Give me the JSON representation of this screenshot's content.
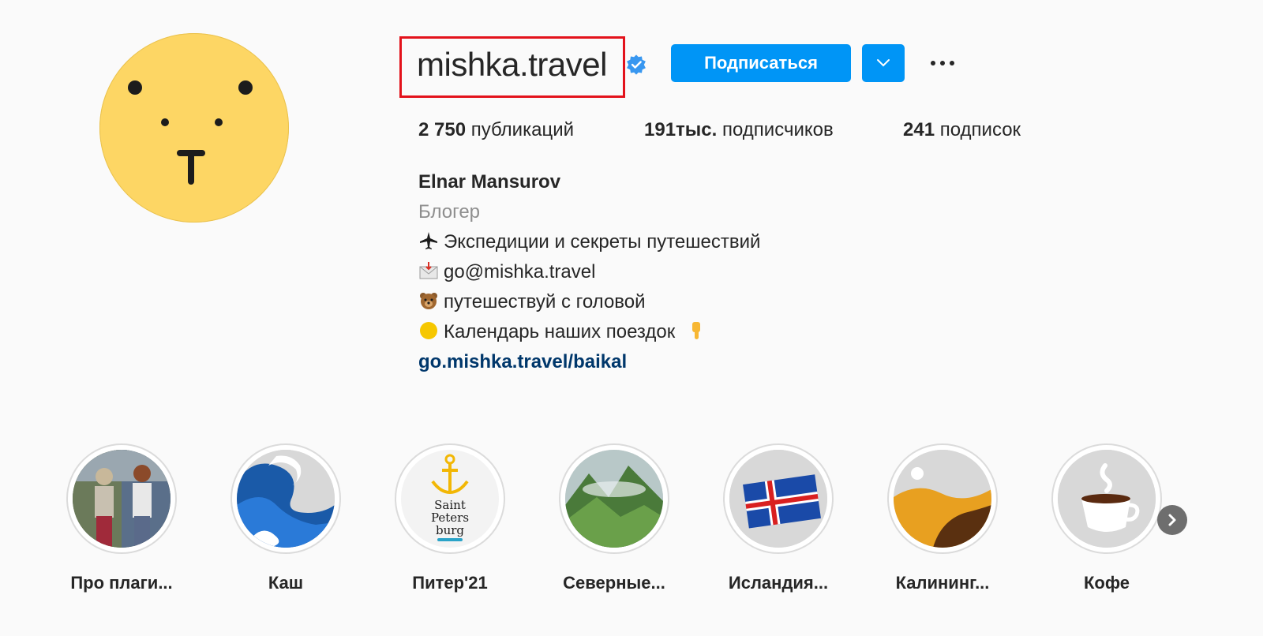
{
  "profile": {
    "username": "mishka.travel",
    "verified": true,
    "follow_label": "Подписаться",
    "stats": {
      "posts_count": "2 750",
      "posts_label": "публикаций",
      "followers_count": "191тыс.",
      "followers_label": "подписчиков",
      "following_count": "241",
      "following_label": "подписок"
    }
  },
  "bio": {
    "name": "Elnar Mansurov",
    "category": "Блогер",
    "lines": [
      {
        "icon": "airplane-emoji",
        "text": "Экспедиции и секреты путешествий"
      },
      {
        "icon": "envelope-emoji",
        "text": "go@mishka.travel"
      },
      {
        "icon": "bear-emoji",
        "text": "путешествуй с головой"
      },
      {
        "icon": "yellow-circle-emoji",
        "text": "Календарь наших поездок",
        "trailing_icon": "pointing-down-emoji"
      }
    ],
    "link": "go.mishka.travel/baikal"
  },
  "highlights": [
    {
      "label": "Про плаги...",
      "cover": "bears-photo"
    },
    {
      "label": "Каш",
      "cover": "wave-illustration"
    },
    {
      "label": "Питер'21",
      "cover": "anchor-logo",
      "cover_text": [
        "Saint",
        "Peters",
        "burg"
      ]
    },
    {
      "label": "Северные...",
      "cover": "mountains-photo"
    },
    {
      "label": "Исландия...",
      "cover": "iceland-flag"
    },
    {
      "label": "Калининг...",
      "cover": "dunes-illustration"
    },
    {
      "label": "Кофе",
      "cover": "coffee-cup-illustration"
    }
  ],
  "colors": {
    "accent": "#0095f6",
    "link": "#00376b",
    "highlight_border": "#e3121b",
    "avatar": "#fdd664"
  }
}
